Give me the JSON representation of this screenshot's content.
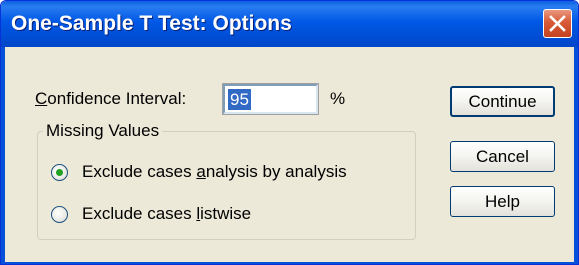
{
  "window": {
    "title": "One-Sample T Test: Options"
  },
  "confidence_interval": {
    "label_prefix": "",
    "label_mnemonic": "C",
    "label_rest": "onfidence Interval:",
    "value": "95",
    "unit": "%"
  },
  "missing_values": {
    "group_title": "Missing Values",
    "options": [
      {
        "label_before": "Exclude cases ",
        "label_mnemonic": "a",
        "label_after": "nalysis by analysis",
        "selected": true
      },
      {
        "label_before": "Exclude cases ",
        "label_mnemonic": "l",
        "label_after": "istwise",
        "selected": false
      }
    ]
  },
  "buttons": {
    "continue": "Continue",
    "cancel": "Cancel",
    "help": "Help"
  },
  "icons": {
    "close": "close-icon"
  },
  "colors": {
    "title_bar": "#0058e6",
    "dialog_background": "#ece9d8",
    "selection": "#316ac5",
    "radio_dot": "#21a121",
    "close_button": "#d85a37"
  }
}
